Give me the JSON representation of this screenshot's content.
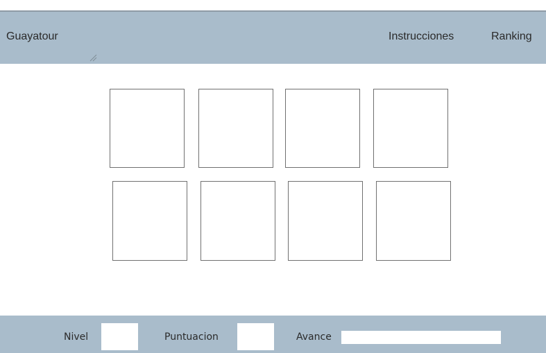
{
  "header": {
    "title": "Guayatour",
    "nav": {
      "instructions": "Instrucciones",
      "ranking": "Ranking"
    }
  },
  "board": {
    "cards": [
      {
        "id": 1
      },
      {
        "id": 2
      },
      {
        "id": 3
      },
      {
        "id": 4
      },
      {
        "id": 5
      },
      {
        "id": 6
      },
      {
        "id": 7
      },
      {
        "id": 8
      }
    ]
  },
  "footer": {
    "level_label": "Nivel",
    "level_value": "",
    "score_label": "Puntuacion",
    "score_value": "",
    "progress_label": "Avance",
    "progress_fraction": 0
  },
  "colors": {
    "bar": "#a9bccb",
    "card_border": "#707070"
  }
}
